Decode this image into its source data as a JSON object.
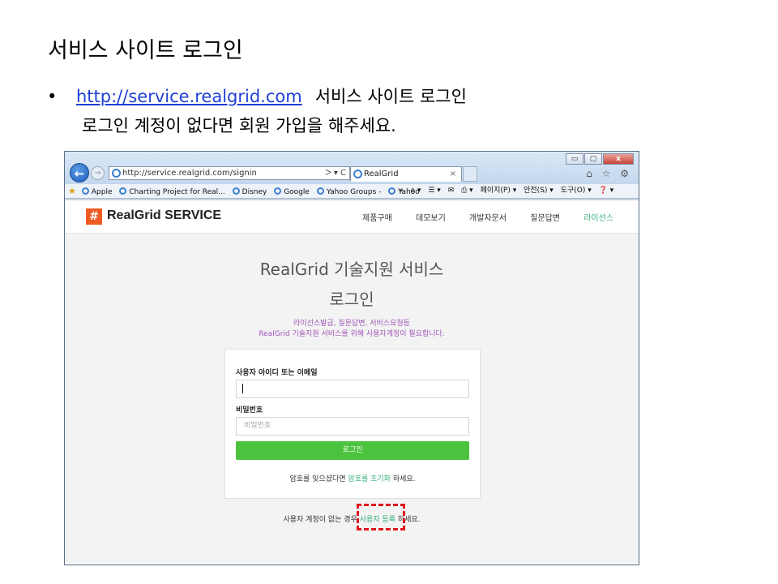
{
  "slide": {
    "title": "서비스 사이트 로그인",
    "bullet": "•",
    "link": "http://service.realgrid.com",
    "line1_tail": "서비스 사이트 로그인",
    "line2": "로그인 계정이 없다면 회원 가입을 해주세요."
  },
  "browser": {
    "window_buttons": [
      "▭",
      "▢",
      "x"
    ],
    "tool_icons": "⌂ ☆ ⚙",
    "address": "http://service.realgrid.com/signin",
    "address_controls": "ᐳ ▾ C",
    "tab_title": "RealGrid",
    "tab_close": "×",
    "favorites": [
      "Apple",
      "Charting Project for Real...",
      "Disney",
      "Google",
      "Yahoo Groups -",
      "Yahoo"
    ],
    "more": "»",
    "tools": [
      "⌂ ▾",
      "☰ ▾",
      "✉",
      "⎙ ▾",
      "페이지(P) ▾",
      "안전(S) ▾",
      "도구(O) ▾",
      "❓ ▾"
    ]
  },
  "site": {
    "logo_symbol": "#",
    "logo_text": "RealGrid SERVICE",
    "nav": [
      "제품구매",
      "데모보기",
      "개발자문서",
      "질문답변",
      "라이선스"
    ],
    "hero_title": "RealGrid 기술지원 서비스",
    "hero_sub": "로그인",
    "desc1": "라이선스발급, 질문답변, 서비스요청등",
    "desc2": "RealGrid 기술지원 서비스를 위해 사용자계정이 필요합니다.",
    "id_label": "사용자 아이디 또는 이메일",
    "pw_label": "비밀번호",
    "pw_placeholder": "비밀번호",
    "login_button": "로그인",
    "forgot_prefix": "암호를 잊으셨다면",
    "forgot_link": "암호를 초기화",
    "forgot_suffix": "하세요.",
    "signup_prefix": "사용자 계정이 없는 경우",
    "signup_link": "사용자 등록",
    "signup_suffix": "하세요."
  },
  "colors": {
    "accent": "#4cc33f",
    "link_green": "#38b07a",
    "logo_orange": "#ef5b23",
    "highlight": "#e0151b"
  }
}
